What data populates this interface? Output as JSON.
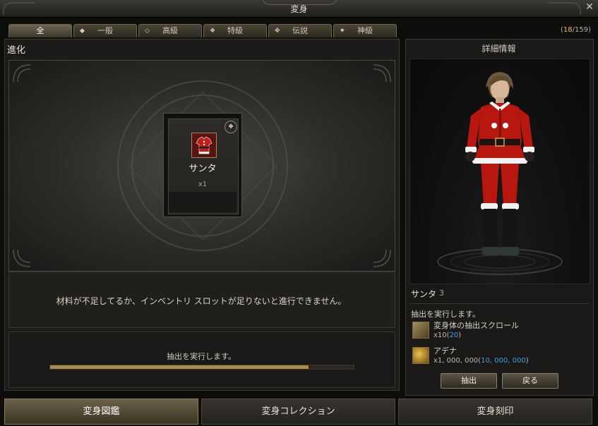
{
  "window": {
    "title": "変身",
    "close_icon": "close-icon"
  },
  "tabs": [
    {
      "label": "全",
      "icon": ""
    },
    {
      "label": "一般",
      "icon": "diamond-small-icon"
    },
    {
      "label": "高級",
      "icon": "diamond-outline-icon"
    },
    {
      "label": "特級",
      "icon": "diamond-cross-icon"
    },
    {
      "label": "伝説",
      "icon": "star-cross-icon"
    },
    {
      "label": "神級",
      "icon": "winged-icon"
    }
  ],
  "counter": {
    "current": "18",
    "total": "159"
  },
  "left": {
    "title": "進化",
    "card": {
      "name": "サンタ",
      "quantity": "x1",
      "badge_icon": "diamond-badge-icon"
    },
    "message": "材料が不足してるか、インベントリ スロットが足りないと進行できません。",
    "extract_text": "抽出を実行します。",
    "progress": 0.85
  },
  "right": {
    "title": "詳細情報",
    "character": {
      "name": "サンタ",
      "level": "3"
    },
    "materials_title": "抽出を実行します。",
    "materials": [
      {
        "name": "変身体の抽出スクロール",
        "need": "x10",
        "have": "20",
        "icon": "scroll-icon"
      },
      {
        "name": "アデナ",
        "need": "x1, 000, 000",
        "have": "10, 000, 000",
        "icon": "gold-coin-icon"
      }
    ],
    "buttons": {
      "extract": "抽出",
      "back": "戻る"
    }
  },
  "bottom_nav": [
    {
      "label": "変身図鑑",
      "active": true
    },
    {
      "label": "変身コレクション",
      "active": false
    },
    {
      "label": "変身刻印",
      "active": false
    }
  ],
  "colors": {
    "accent_gold": "#e8c05a",
    "have_blue": "#3aa0e8",
    "santa_red": "#c0201a"
  }
}
